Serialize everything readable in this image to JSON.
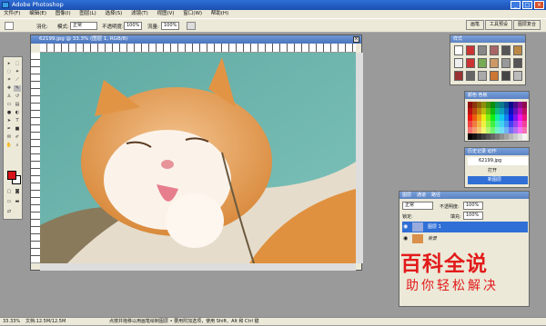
{
  "app": {
    "title": "Adobe Photoshop",
    "minimize": "_",
    "maximize": "□",
    "close": "×"
  },
  "menu": [
    "文件(F)",
    "编辑(E)",
    "图像(I)",
    "图层(L)",
    "选择(S)",
    "滤镜(T)",
    "视图(V)",
    "窗口(W)",
    "帮助(H)"
  ],
  "options": {
    "feather_label": "羽化:",
    "mode_label": "模式:",
    "mode_value": "正常",
    "opacity_label": "不透明度:",
    "opacity_value": "100%",
    "flow_label": "流量:",
    "flow_value": "100%"
  },
  "top_tabs": [
    "画笔",
    "工具预设",
    "图层复合"
  ],
  "document": {
    "title": "62199.jpg @ 33.3% (图层 1, RGB/8)"
  },
  "style_panel": {
    "title": "样式"
  },
  "color_panel": {
    "title": "颜色 色板"
  },
  "history_panel": {
    "title": "历史记录 动作",
    "file": "62199.jpg",
    "items": [
      "打开",
      "新图层"
    ]
  },
  "layers_panel": {
    "tabs": [
      "图层",
      "通道",
      "路径"
    ],
    "mode": "正常",
    "opacity_label": "不透明度:",
    "opacity_value": "100%",
    "lock_label": "锁定:",
    "fill_label": "填充:",
    "fill_value": "100%",
    "layers": [
      "图层 1",
      "背景"
    ]
  },
  "status": {
    "zoom": "33.33%",
    "doc": "文档:12.5M/12.5M",
    "hint": "点按并拖移以用画笔绘制图层 • 要用附加选项，使用 Shift、Alt 和 Ctrl 键"
  },
  "watermark": {
    "line1": "百科全说",
    "line2": "助你轻松解决"
  },
  "colors": {
    "foreground": "#d8141b",
    "background": "#ffffff",
    "accent": "#2f6fd6"
  }
}
